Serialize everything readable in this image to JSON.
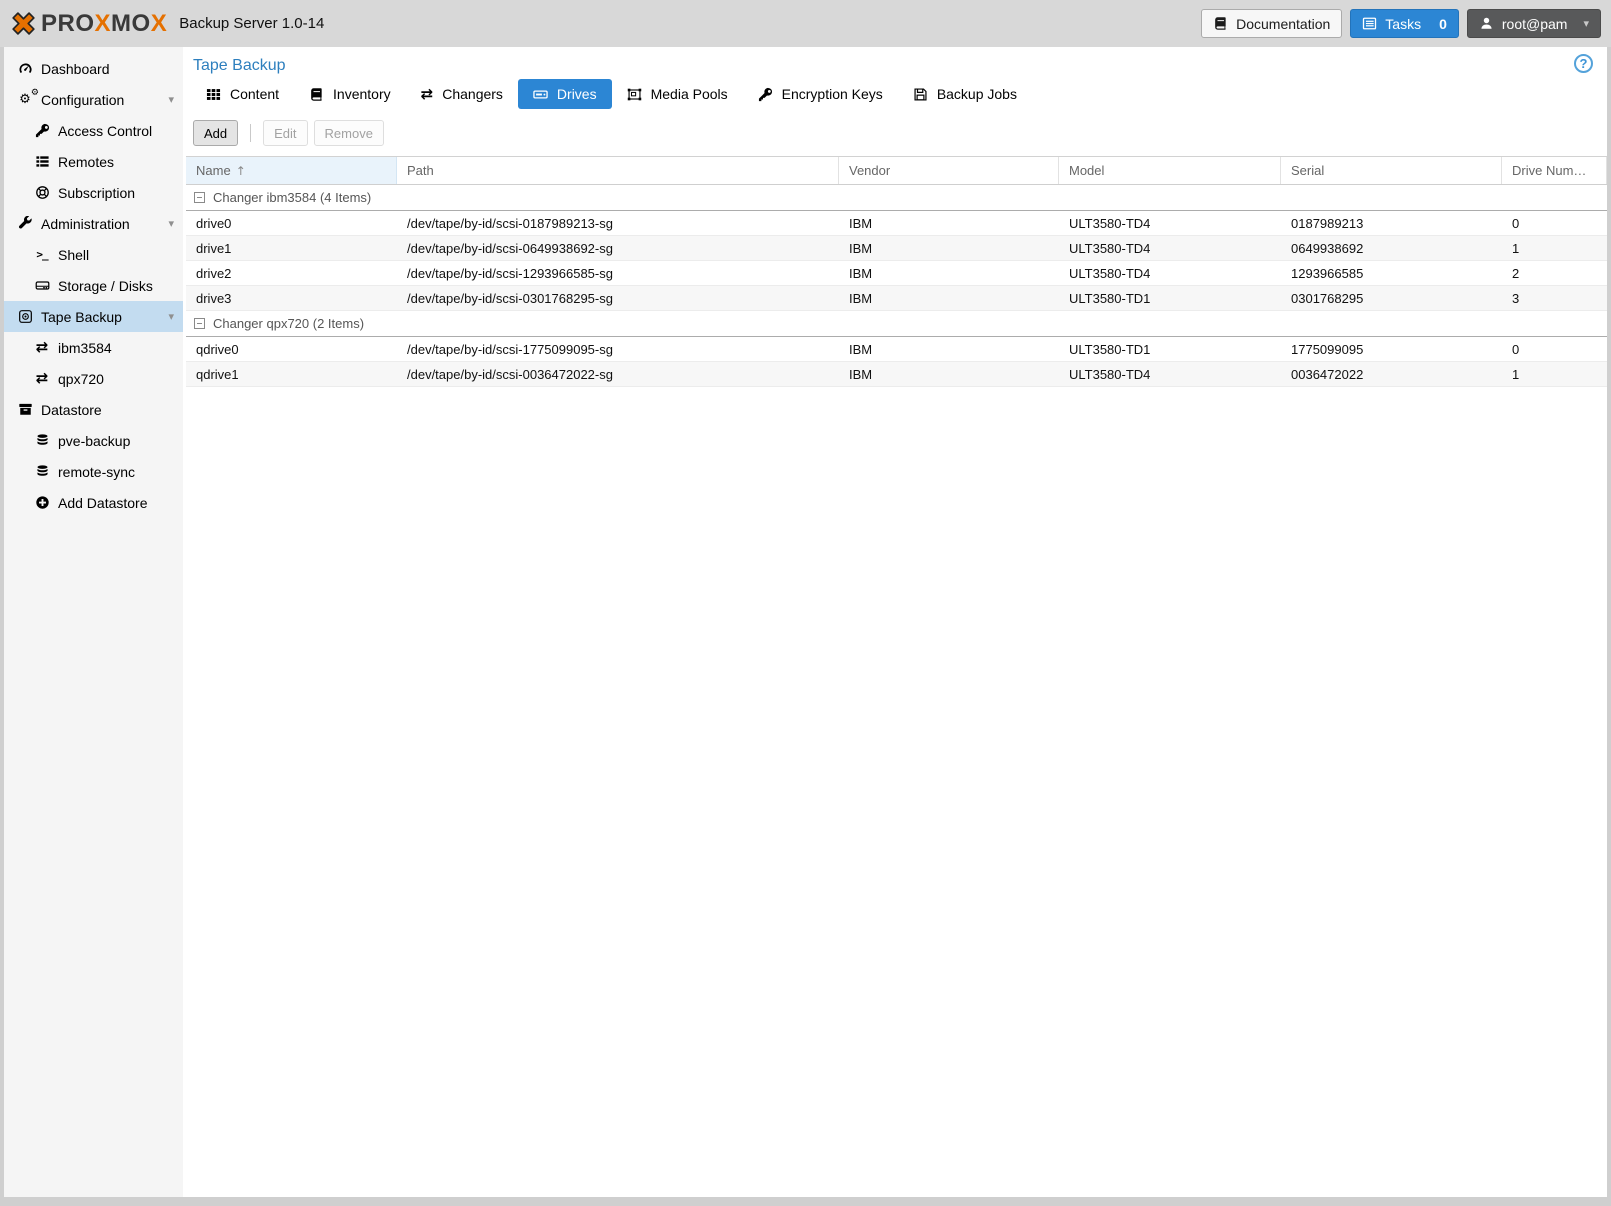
{
  "logo": {
    "part1": "PRO",
    "part2": "X",
    "part3": "MO",
    "part4": "X"
  },
  "header": {
    "product": "Backup Server 1.0-14",
    "documentation_label": "Documentation",
    "tasks_label": "Tasks",
    "tasks_count": "0",
    "user_label": "root@pam"
  },
  "icons": {
    "gear_glyph": "⚙",
    "changer_glyph": "⇄",
    "shell_glyph": ">_",
    "caret_down_glyph": "▾",
    "sort_asc_glyph": "↑",
    "help_glyph": "?",
    "user_chevron_glyph": "▾"
  },
  "sidebar": {
    "items": [
      {
        "label": "Dashboard"
      },
      {
        "label": "Configuration",
        "children": [
          {
            "label": "Access Control"
          },
          {
            "label": "Remotes"
          },
          {
            "label": "Subscription"
          }
        ]
      },
      {
        "label": "Administration",
        "children": [
          {
            "label": "Shell"
          },
          {
            "label": "Storage / Disks"
          }
        ]
      },
      {
        "label": "Tape Backup",
        "children": [
          {
            "label": "ibm3584"
          },
          {
            "label": "qpx720"
          }
        ]
      },
      {
        "label": "Datastore",
        "children": [
          {
            "label": "pve-backup"
          },
          {
            "label": "remote-sync"
          },
          {
            "label": "Add Datastore"
          }
        ]
      }
    ]
  },
  "main": {
    "title": "Tape Backup",
    "tabs": [
      {
        "label": "Content"
      },
      {
        "label": "Inventory"
      },
      {
        "label": "Changers"
      },
      {
        "label": "Drives",
        "active": true
      },
      {
        "label": "Media Pools"
      },
      {
        "label": "Encryption Keys"
      },
      {
        "label": "Backup Jobs"
      }
    ],
    "toolbar": {
      "add": "Add",
      "edit": "Edit",
      "remove": "Remove"
    },
    "table": {
      "columns": [
        "Name",
        "Path",
        "Vendor",
        "Model",
        "Serial",
        "Drive Num…"
      ],
      "groups": [
        {
          "label": "Changer ibm3584 (4 Items)",
          "rows": [
            {
              "name": "drive0",
              "path": "/dev/tape/by-id/scsi-0187989213-sg",
              "vendor": "IBM",
              "model": "ULT3580-TD4",
              "serial": "0187989213",
              "drive_number": "0"
            },
            {
              "name": "drive1",
              "path": "/dev/tape/by-id/scsi-0649938692-sg",
              "vendor": "IBM",
              "model": "ULT3580-TD4",
              "serial": "0649938692",
              "drive_number": "1"
            },
            {
              "name": "drive2",
              "path": "/dev/tape/by-id/scsi-1293966585-sg",
              "vendor": "IBM",
              "model": "ULT3580-TD4",
              "serial": "1293966585",
              "drive_number": "2"
            },
            {
              "name": "drive3",
              "path": "/dev/tape/by-id/scsi-0301768295-sg",
              "vendor": "IBM",
              "model": "ULT3580-TD1",
              "serial": "0301768295",
              "drive_number": "3"
            }
          ]
        },
        {
          "label": "Changer qpx720 (2 Items)",
          "rows": [
            {
              "name": "qdrive0",
              "path": "/dev/tape/by-id/scsi-1775099095-sg",
              "vendor": "IBM",
              "model": "ULT3580-TD1",
              "serial": "1775099095",
              "drive_number": "0"
            },
            {
              "name": "qdrive1",
              "path": "/dev/tape/by-id/scsi-0036472022-sg",
              "vendor": "IBM",
              "model": "ULT3580-TD4",
              "serial": "0036472022",
              "drive_number": "1"
            }
          ]
        }
      ]
    }
  },
  "colors": {
    "accent_blue": "#2c86d4",
    "proxmox_orange": "#e57000",
    "selected_row_blue": "#c3dcf0",
    "sorted_column_bg": "#e9f3fb",
    "header_bar_gray": "#d8d8d8"
  }
}
